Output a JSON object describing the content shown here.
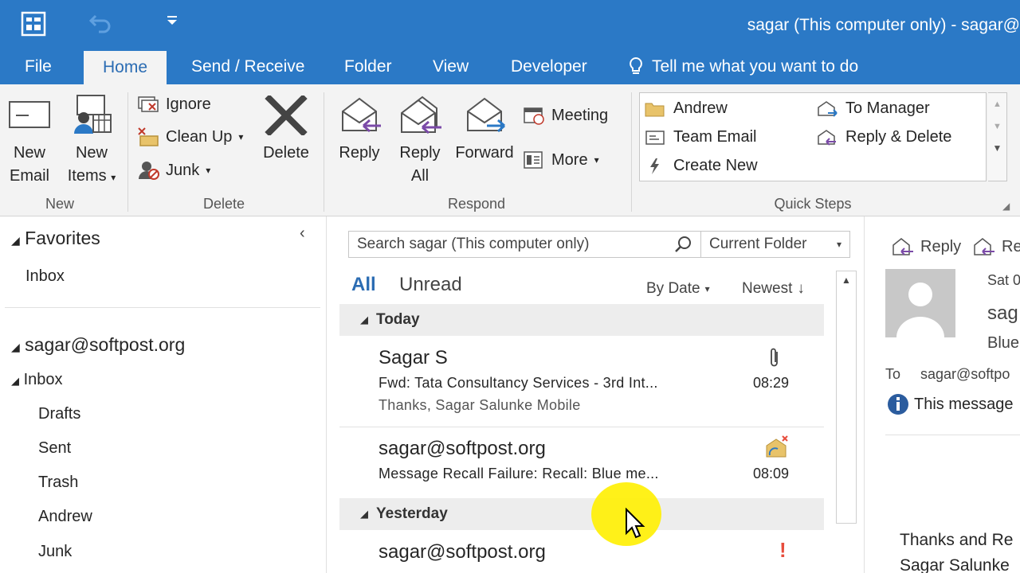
{
  "title": "sagar (This computer only) - sagar@",
  "tabs": [
    {
      "label": "File"
    },
    {
      "label": "Home"
    },
    {
      "label": "Send / Receive"
    },
    {
      "label": "Folder"
    },
    {
      "label": "View"
    },
    {
      "label": "Developer"
    }
  ],
  "tell_me": "Tell me what you want to do",
  "ribbon": {
    "new": {
      "new_email_l1": "New",
      "new_email_l2": "Email",
      "new_items_l1": "New",
      "new_items_l2": "Items",
      "group": "New"
    },
    "delete": {
      "ignore": "Ignore",
      "cleanup": "Clean Up",
      "junk": "Junk",
      "delete": "Delete",
      "group": "Delete"
    },
    "respond": {
      "reply": "Reply",
      "reply_all_l1": "Reply",
      "reply_all_l2": "All",
      "forward": "Forward",
      "meeting": "Meeting",
      "more": "More",
      "group": "Respond"
    },
    "quick_steps": {
      "items": [
        {
          "label": "Andrew"
        },
        {
          "label": "Team Email"
        },
        {
          "label": "Create New"
        },
        {
          "label": "To Manager"
        },
        {
          "label": "Reply & Delete"
        }
      ],
      "group": "Quick Steps"
    }
  },
  "folders": {
    "favorites": "Favorites",
    "fav_inbox": "Inbox",
    "account": "sagar@softpost.org",
    "inbox": "Inbox",
    "items": [
      {
        "label": "Drafts"
      },
      {
        "label": "Sent"
      },
      {
        "label": "Trash"
      },
      {
        "label": "Andrew"
      },
      {
        "label": "Junk"
      }
    ]
  },
  "list": {
    "search_placeholder": "Search sagar (This computer only)",
    "scope": "Current Folder",
    "filter_all": "All",
    "filter_unread": "Unread",
    "sort_by": "By Date",
    "order": "Newest",
    "groups": {
      "today": "Today",
      "yesterday": "Yesterday"
    },
    "messages": [
      {
        "from": "Sagar S",
        "subject": "Fwd: Tata Consultancy Services - 3rd Int...",
        "preview": "Thanks,  Sagar Salunke  Mobile",
        "time": "08:29"
      },
      {
        "from": "sagar@softpost.org",
        "subject": "Message Recall Failure: Recall: Blue me...",
        "time": "08:09"
      },
      {
        "from": "sagar@softpost.org"
      }
    ]
  },
  "reading": {
    "reply": "Reply",
    "reply_all_cut": "Re",
    "date_cut": "Sat 0",
    "from_cut": "sag",
    "subject_cut": "Blue",
    "to_label": "To",
    "to_value": "sagar@softpo",
    "info": "This message",
    "sign1": "Thanks and Re",
    "sign2": "Sagar Salunke"
  },
  "colors": {
    "accent": "#2b79c6",
    "ribbon_bg": "#f3f3f3",
    "group_bar": "#ededed",
    "link_blue": "#2b6cb3",
    "highlight": "#fff000"
  }
}
